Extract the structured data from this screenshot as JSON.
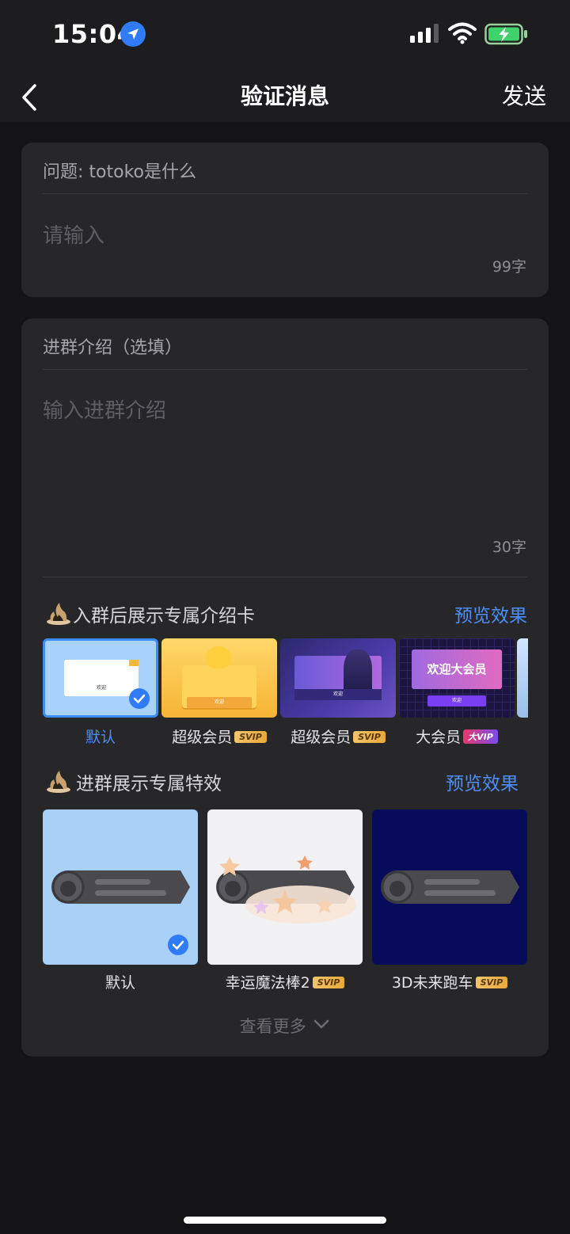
{
  "status": {
    "time": "15:04"
  },
  "nav": {
    "title": "验证消息",
    "send_label": "发送"
  },
  "question_card": {
    "question": "问题: totoko是什么",
    "placeholder": "请输入",
    "counter": "99字"
  },
  "intro_card": {
    "label": "进群介绍（选填）",
    "placeholder": "输入进群介绍",
    "counter": "30字",
    "cards_section": {
      "title": "入群后展示专属介绍卡",
      "preview_label": "预览效果",
      "items": [
        {
          "label": "默认",
          "badge": "",
          "selected": true,
          "inner_text": "欢迎"
        },
        {
          "label": "超级会员",
          "badge": "SVIP",
          "selected": false,
          "inner_text": "欢迎"
        },
        {
          "label": "超级会员",
          "badge": "SVIP",
          "selected": false,
          "inner_text": "欢迎"
        },
        {
          "label": "大会员",
          "badge": "大VIP",
          "selected": false,
          "inner_text": "欢迎",
          "banner_text": "欢迎大会员"
        }
      ]
    },
    "effects_section": {
      "title": "进群展示专属特效",
      "preview_label": "预览效果",
      "items": [
        {
          "label": "默认",
          "badge": "",
          "selected": true
        },
        {
          "label": "幸运魔法棒2",
          "badge": "SVIP",
          "selected": false
        },
        {
          "label": "3D未来跑车",
          "badge": "SVIP",
          "selected": false
        }
      ]
    },
    "more_label": "查看更多"
  },
  "colors": {
    "accent": "#4d8ff5",
    "card_bg": "#27272a",
    "page_bg": "#141416"
  }
}
